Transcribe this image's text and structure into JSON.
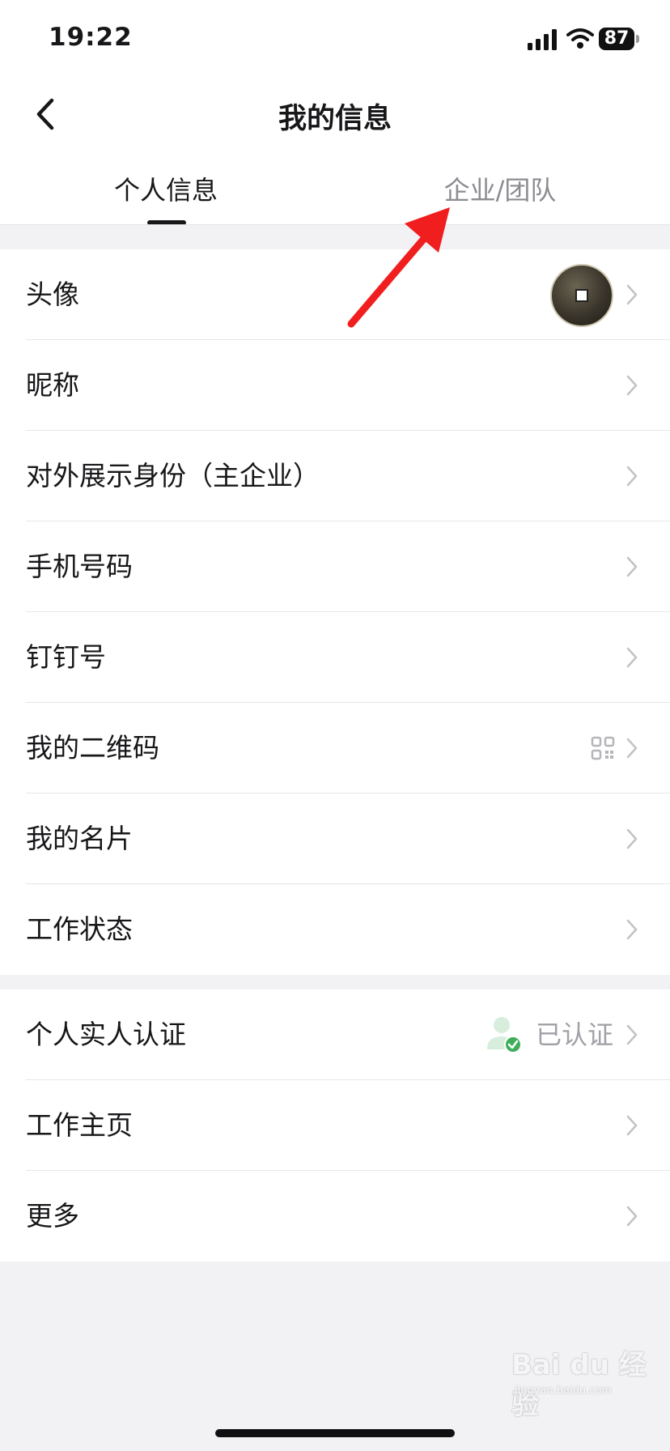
{
  "status": {
    "time": "19:22",
    "battery": "87"
  },
  "header": {
    "title": "我的信息"
  },
  "tabs": [
    {
      "label": "个人信息",
      "active": true
    },
    {
      "label": "企业/团队",
      "active": false
    }
  ],
  "group1": [
    {
      "label": "头像",
      "accessory": "avatar"
    },
    {
      "label": "昵称"
    },
    {
      "label": "对外展示身份（主企业）"
    },
    {
      "label": "手机号码"
    },
    {
      "label": "钉钉号"
    },
    {
      "label": "我的二维码",
      "accessory": "qr-code-icon"
    },
    {
      "label": "我的名片"
    },
    {
      "label": "工作状态"
    }
  ],
  "group2": [
    {
      "label": "个人实人认证",
      "accessory": "verified-user-icon",
      "value": "已认证"
    },
    {
      "label": "工作主页"
    },
    {
      "label": "更多"
    }
  ],
  "watermark": {
    "brand": "Bai du 经验",
    "url": "jingyan.baidu.com"
  },
  "colors": {
    "background": "#f2f2f5",
    "surface": "#ffffff",
    "annotation_arrow": "#f01e1e",
    "verified_green": "#3fae5a"
  }
}
